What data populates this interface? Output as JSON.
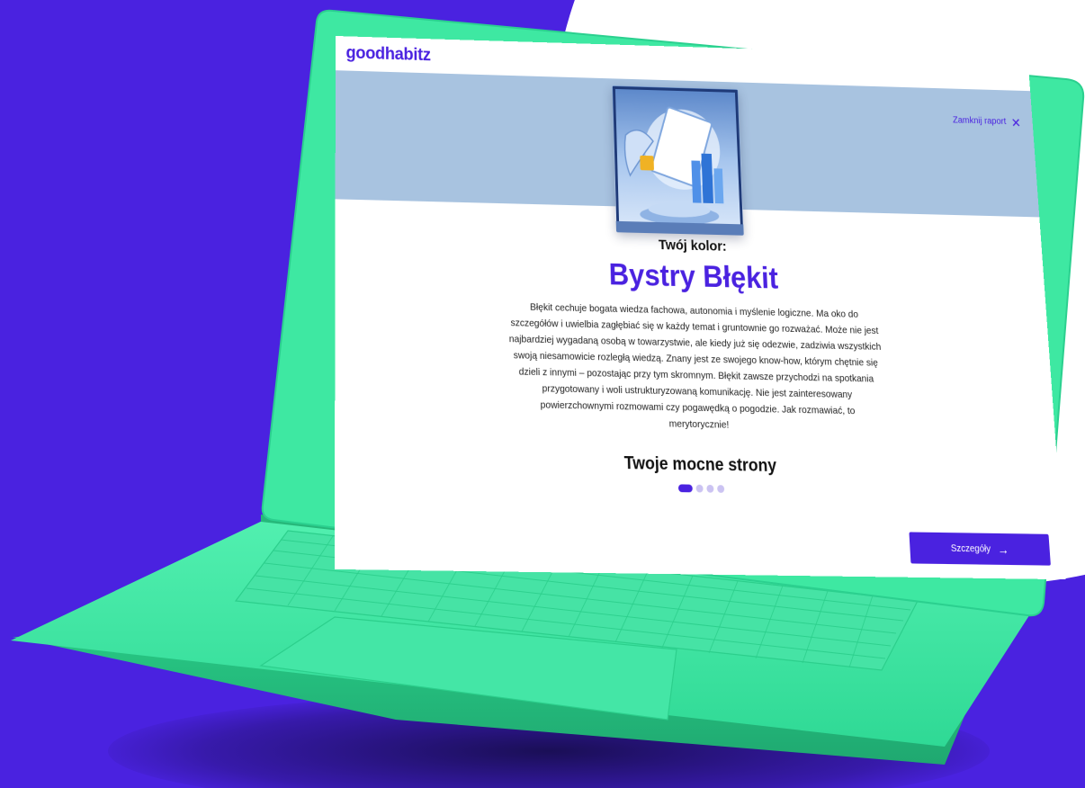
{
  "app": {
    "logo": "goodhabitz",
    "close_label": "Zamknij raport",
    "close_icon": "close-icon"
  },
  "report": {
    "eyebrow": "Twój kolor:",
    "title": "Bystry Błękit",
    "description": "Błękit cechuje bogata wiedza fachowa, autonomia i myślenie logiczne. Ma oko do szczegółów i uwielbia zagłębiać się w każdy temat i gruntownie go rozważać. Może nie jest najbardziej wygadaną osobą w towarzystwie, ale kiedy już się odezwie, zadziwia wszystkich swoją niesamowicie rozległą wiedzą. Znany jest ze swojego know-how, którym chętnie się dzieli z innymi – pozostając przy tym skromnym. Błękit zawsze przychodzi na spotkania przygotowany i woli ustrukturyzowaną komunikację. Nie jest zainteresowany powierzchownymi rozmowami czy pogawędką o pogodzie. Jak rozmawiać, to merytorycznie!",
    "strengths_heading": "Twoje mocne strony",
    "carousel": {
      "total": 4,
      "active": 1
    },
    "details_label": "Szczegóły",
    "details_icon": "arrow-right-icon"
  },
  "colors": {
    "brand": "#4a22e0",
    "laptop": "#3ee8a2",
    "banner": "#a8c3e0"
  }
}
